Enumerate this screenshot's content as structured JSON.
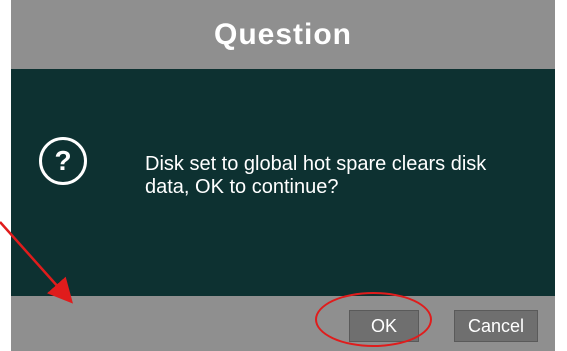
{
  "dialog": {
    "title": "Question",
    "icon": "question-circle-icon",
    "message": "Disk set to global hot spare clears disk\n data, OK to continue?",
    "buttons": {
      "ok_label": "OK",
      "cancel_label": "Cancel"
    }
  },
  "colors": {
    "frame": "#8f8f8f",
    "body": "#0d3131",
    "button": "#6f6f6f",
    "annotation": "#e01c1c"
  }
}
